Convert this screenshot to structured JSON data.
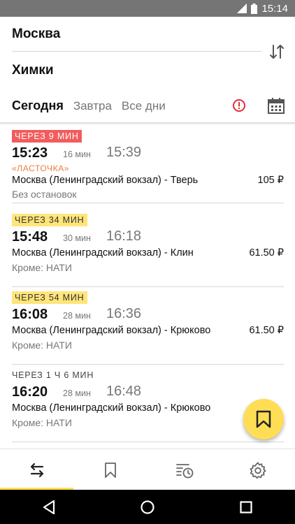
{
  "status_bar": {
    "time": "15:14"
  },
  "search": {
    "from": "Москва",
    "to": "Химки"
  },
  "tabs": [
    {
      "label": "Сегодня",
      "active": true
    },
    {
      "label": "Завтра",
      "active": false
    },
    {
      "label": "Все дни",
      "active": false
    }
  ],
  "trains": [
    {
      "badge": "ЧЕРЕЗ 9 МИН",
      "badge_style": "red",
      "departure": "15:23",
      "duration": "16 мин",
      "arrival": "15:39",
      "brand": "«ЛАСТОЧКА»",
      "route": "Москва (Ленинградский вокзал) - Тверь",
      "price": "105 ₽",
      "stops": "Без остановок"
    },
    {
      "badge": "ЧЕРЕЗ 34 МИН",
      "badge_style": "yellow",
      "departure": "15:48",
      "duration": "30 мин",
      "arrival": "16:18",
      "brand": "",
      "route": "Москва (Ленинградский вокзал) - Клин",
      "price": "61.50 ₽",
      "stops": "Кроме: НАТИ"
    },
    {
      "badge": "ЧЕРЕЗ 54 МИН",
      "badge_style": "yellow",
      "departure": "16:08",
      "duration": "28 мин",
      "arrival": "16:36",
      "brand": "",
      "route": "Москва (Ленинградский вокзал) - Крюково",
      "price": "61.50 ₽",
      "stops": "Кроме: НАТИ"
    },
    {
      "badge": "ЧЕРЕЗ 1 Ч 6 МИН",
      "badge_style": "plain",
      "departure": "16:20",
      "duration": "28 мин",
      "arrival": "16:48",
      "brand": "",
      "route": "Москва (Ленинградский вокзал) - Крюково",
      "price": "",
      "stops": "Кроме: НАТИ"
    }
  ],
  "icons": {
    "swap": "swap-vertical-icon",
    "alert": "alert-circle-icon",
    "calendar": "calendar-icon",
    "fab": "bookmark-icon",
    "nav": [
      "routes-icon",
      "bookmark-icon",
      "history-icon",
      "settings-icon"
    ]
  },
  "colors": {
    "accent": "#ffdd55",
    "alert": "#e0303a",
    "badge_red": "#f25c5c",
    "badge_yellow": "#ffe57a",
    "brand": "#f07b3c"
  }
}
